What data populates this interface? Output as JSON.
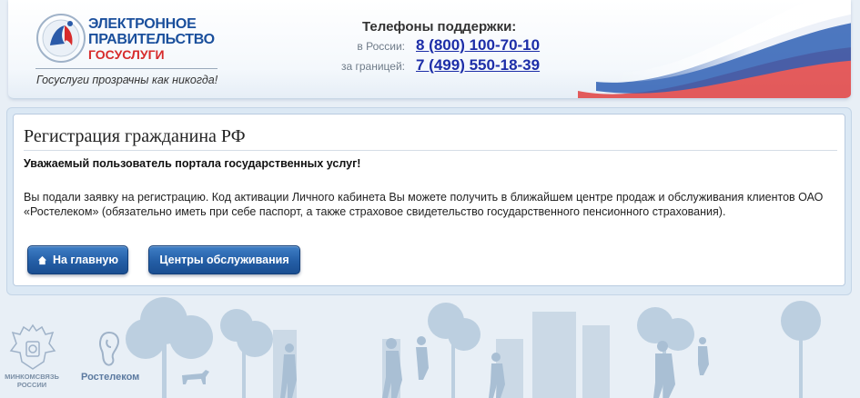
{
  "header": {
    "logo_line1": "ЭЛЕКТРОННОЕ",
    "logo_line2": "ПРАВИТЕЛЬСТВО",
    "logo_line3": "ГОСУСЛУГИ",
    "tagline": "Госуслуги прозрачны как никогда!",
    "support_title": "Телефоны поддержки:",
    "phones": [
      {
        "label": "в России:",
        "number": "8 (800) 100-70-10"
      },
      {
        "label": "за границей:",
        "number": "7 (499) 550-18-39"
      }
    ]
  },
  "main": {
    "title": "Регистрация гражданина РФ",
    "greeting": "Уважаемый пользователь портала государственных услуг!",
    "message": "Вы подали заявку на регистрацию. Код активации Личного кабинета Вы можете получить в ближайшем центре продаж и обслуживания клиентов ОАО «Ростелеком» (обязательно иметь при себе паспорт, а также страховое свидетельство государственного пенсионного страхования).",
    "buttons": {
      "home": "На главную",
      "centers": "Центры обслуживания"
    }
  },
  "footer": {
    "ministry_label_line1": "МИНКОМСВЯЗЬ",
    "ministry_label_line2": "РОССИИ",
    "rostelecom_label": "Ростелеком"
  },
  "colors": {
    "brand_blue": "#1a4f9c",
    "brand_red": "#d72b2b",
    "link_blue": "#1d2ea8",
    "button_blue": "#245ea6"
  }
}
